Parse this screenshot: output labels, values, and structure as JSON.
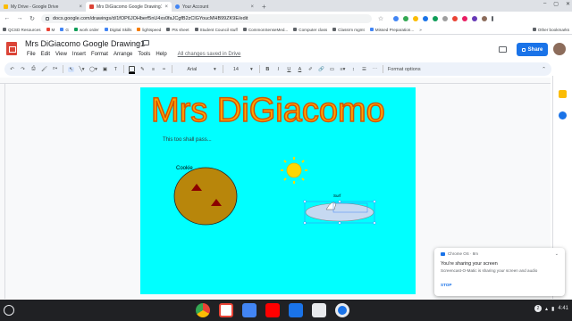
{
  "browser": {
    "tabs": [
      {
        "label": "My Drive - Google Drive",
        "active": false,
        "icon": "drive-icon"
      },
      {
        "label": "Mrs DiGiacomo Google Drawing1",
        "active": true,
        "icon": "drawings-icon"
      },
      {
        "label": "Your Account",
        "active": false,
        "icon": "account-icon"
      }
    ],
    "new_tab": "+",
    "url": "docs.google.com/drawings/d/1fOP6JOHberf5nU4xs0faJCgfB2zClGYoucMHB99ZK9E/edit"
  },
  "bookmarks": [
    "QCSD Resources",
    "M",
    "G",
    "work order",
    "Digital Skills",
    "lightspeed",
    "Pts sheet",
    "Student Council stuff",
    "CommonSenseMed...",
    "Computer class",
    "Classrm mgmt",
    "Missed Preparation..."
  ],
  "bookmarks_overflow": "»",
  "other_bookmarks": "Other bookmarks",
  "docs": {
    "title": "Mrs DiGiacomo Google Drawing1",
    "menu": [
      "File",
      "Edit",
      "View",
      "Insert",
      "Format",
      "Arrange",
      "Tools",
      "Help"
    ],
    "save_status": "All changes saved in Drive",
    "share_label": "Share"
  },
  "toolbar": {
    "font": "Arial",
    "font_size": "14",
    "bold": "B",
    "italic": "I",
    "underline": "U",
    "text_color": "A",
    "format_options": "Format options"
  },
  "drawing": {
    "title_text": "Mrs DiGiacomo",
    "subtitle_text": "This too shall pass...",
    "cookie_label": "Cookie",
    "surf_label": "Surf",
    "background_color": "#00ffff",
    "title_color": "#ffa500",
    "cookie_color": "#b8860b",
    "sun_color": "#ffd700",
    "board_color": "#c6d9f1"
  },
  "notification": {
    "source": "Chrome OS · 8m",
    "title": "You're sharing your screen",
    "body": "Screencast-O-Matic is sharing your screen and audio",
    "action": "STOP"
  },
  "shelf": {
    "apps": [
      "chrome-icon",
      "gmail-icon",
      "docs-icon",
      "youtube-icon",
      "files-icon",
      "camera-icon",
      "screencast-icon"
    ],
    "badge": "2",
    "time": "4:41"
  }
}
